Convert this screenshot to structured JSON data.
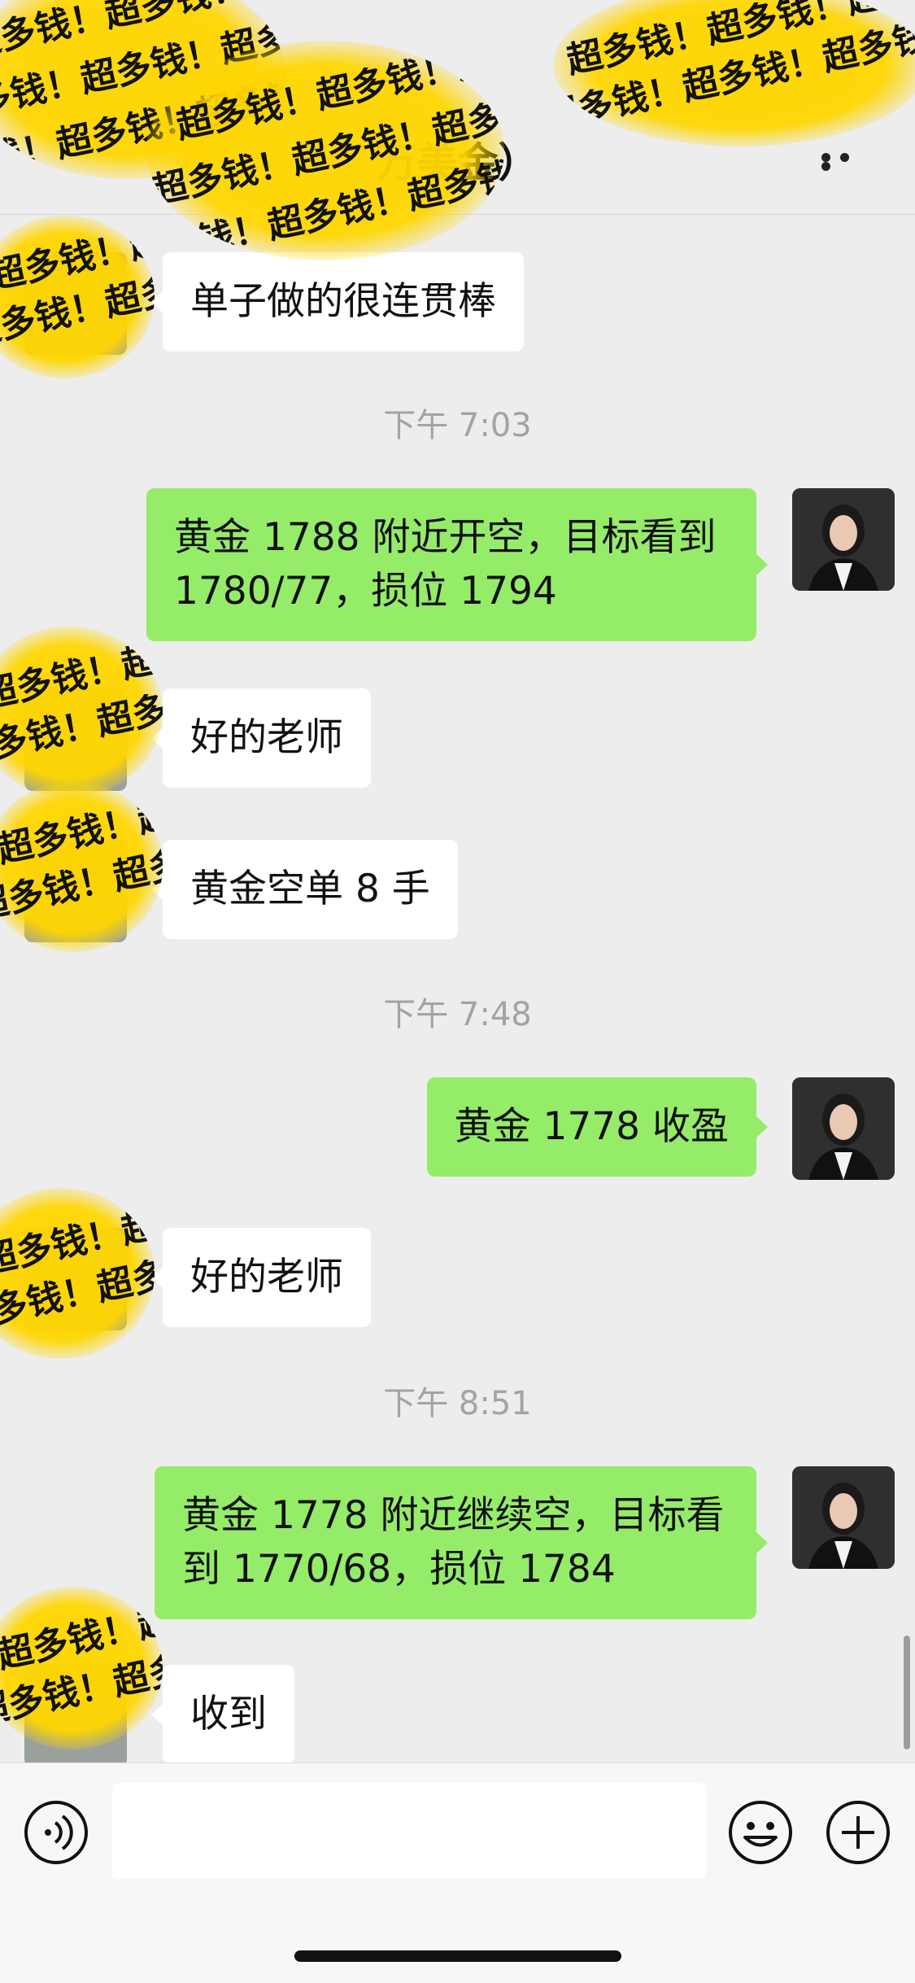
{
  "header": {
    "title": "万美金）"
  },
  "sticker_text": "超多钱！超多钱！超多钱！",
  "messages": [
    {
      "kind": "in",
      "text": "单子做的很连贯棒"
    },
    {
      "kind": "time",
      "text": "下午 7:03"
    },
    {
      "kind": "out",
      "text": "黄金 1788 附近开空，目标看到 1780/77，损位 1794"
    },
    {
      "kind": "in",
      "text": "好的老师"
    },
    {
      "kind": "in",
      "text": "黄金空单 8 手"
    },
    {
      "kind": "time",
      "text": "下午 7:48"
    },
    {
      "kind": "out",
      "text": "黄金 1778 收盈"
    },
    {
      "kind": "in",
      "text": "好的老师"
    },
    {
      "kind": "time",
      "text": "下午 8:51"
    },
    {
      "kind": "out",
      "text": "黄金 1778 附近继续空，目标看到 1770/68，损位 1784"
    },
    {
      "kind": "in",
      "text": "收到"
    }
  ],
  "input": {
    "placeholder": ""
  },
  "icons": {
    "voice": "voice-icon",
    "emoji": "emoji-icon",
    "plus": "plus-icon",
    "more": "more-icon"
  },
  "colors": {
    "outgoing_bubble": "#95ec69",
    "incoming_bubble": "#ffffff",
    "background": "#ededed"
  }
}
